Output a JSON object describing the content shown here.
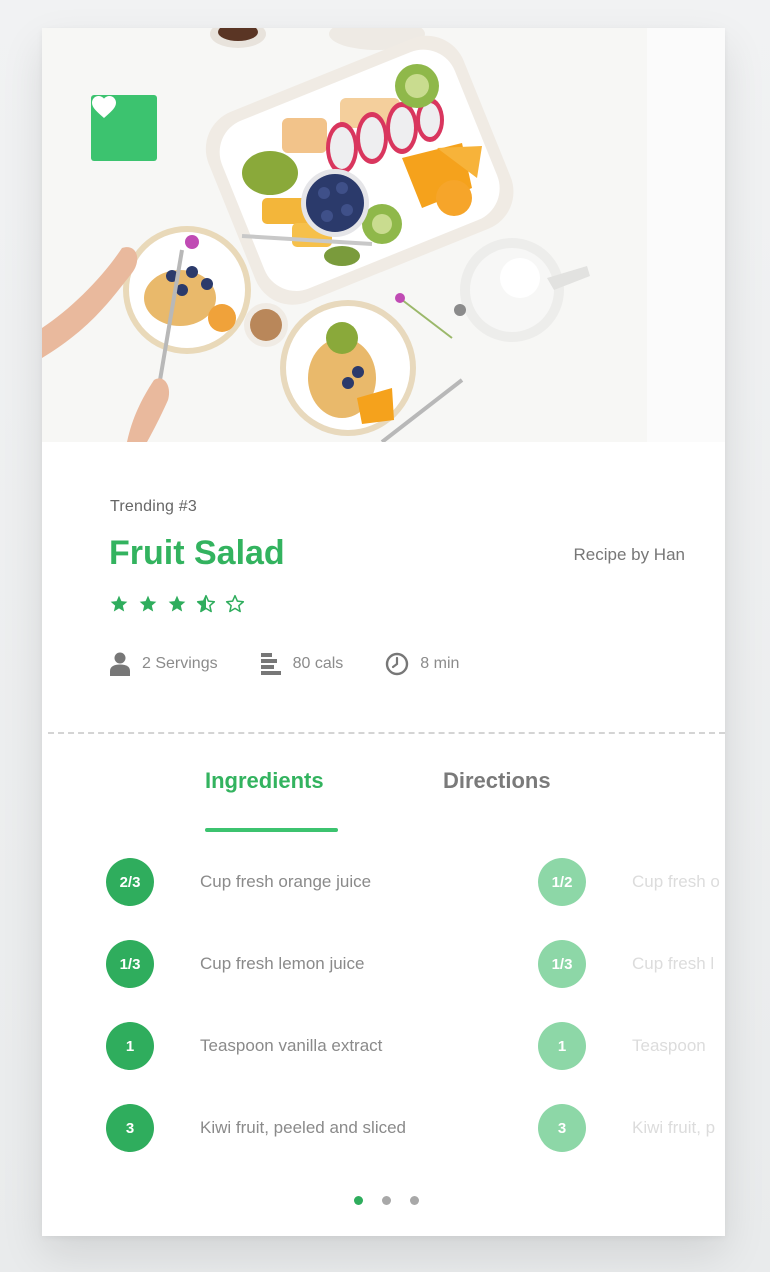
{
  "recipe": {
    "trending": "Trending #3",
    "title": "Fruit Salad",
    "author": "Recipe by Han",
    "rating": 3.5,
    "rating_max": 5
  },
  "stats": {
    "servings": "2 Servings",
    "calories": "80 cals",
    "time": "8 min"
  },
  "tabs": {
    "ingredients": "Ingredients",
    "directions": "Directions"
  },
  "ingredients": [
    {
      "qty": "2/3",
      "text": "Cup fresh orange juice"
    },
    {
      "qty": "1/3",
      "text": "Cup fresh lemon juice"
    },
    {
      "qty": "1",
      "text": "Teaspoon vanilla extract"
    },
    {
      "qty": "3",
      "text": "Kiwi fruit, peeled and sliced"
    }
  ],
  "ingredients_next": [
    {
      "qty": "1/2",
      "text": "Cup fresh o"
    },
    {
      "qty": "1/3",
      "text": "Cup fresh l"
    },
    {
      "qty": "1",
      "text": "Teaspoon"
    },
    {
      "qty": "3",
      "text": "Kiwi fruit, p"
    }
  ],
  "pagination": {
    "pages": 3,
    "active": 1
  },
  "icons": {
    "favorite": "heart-icon",
    "servings": "person-icon",
    "calories": "bars-icon",
    "time": "clock-icon",
    "star_full": "star-icon",
    "star_half": "star-half-icon",
    "star_empty": "star-outline-icon"
  },
  "colors": {
    "accent": "#3cc36f",
    "accent_dark": "#2fad5d",
    "accent_light": "#8dd7a7"
  }
}
